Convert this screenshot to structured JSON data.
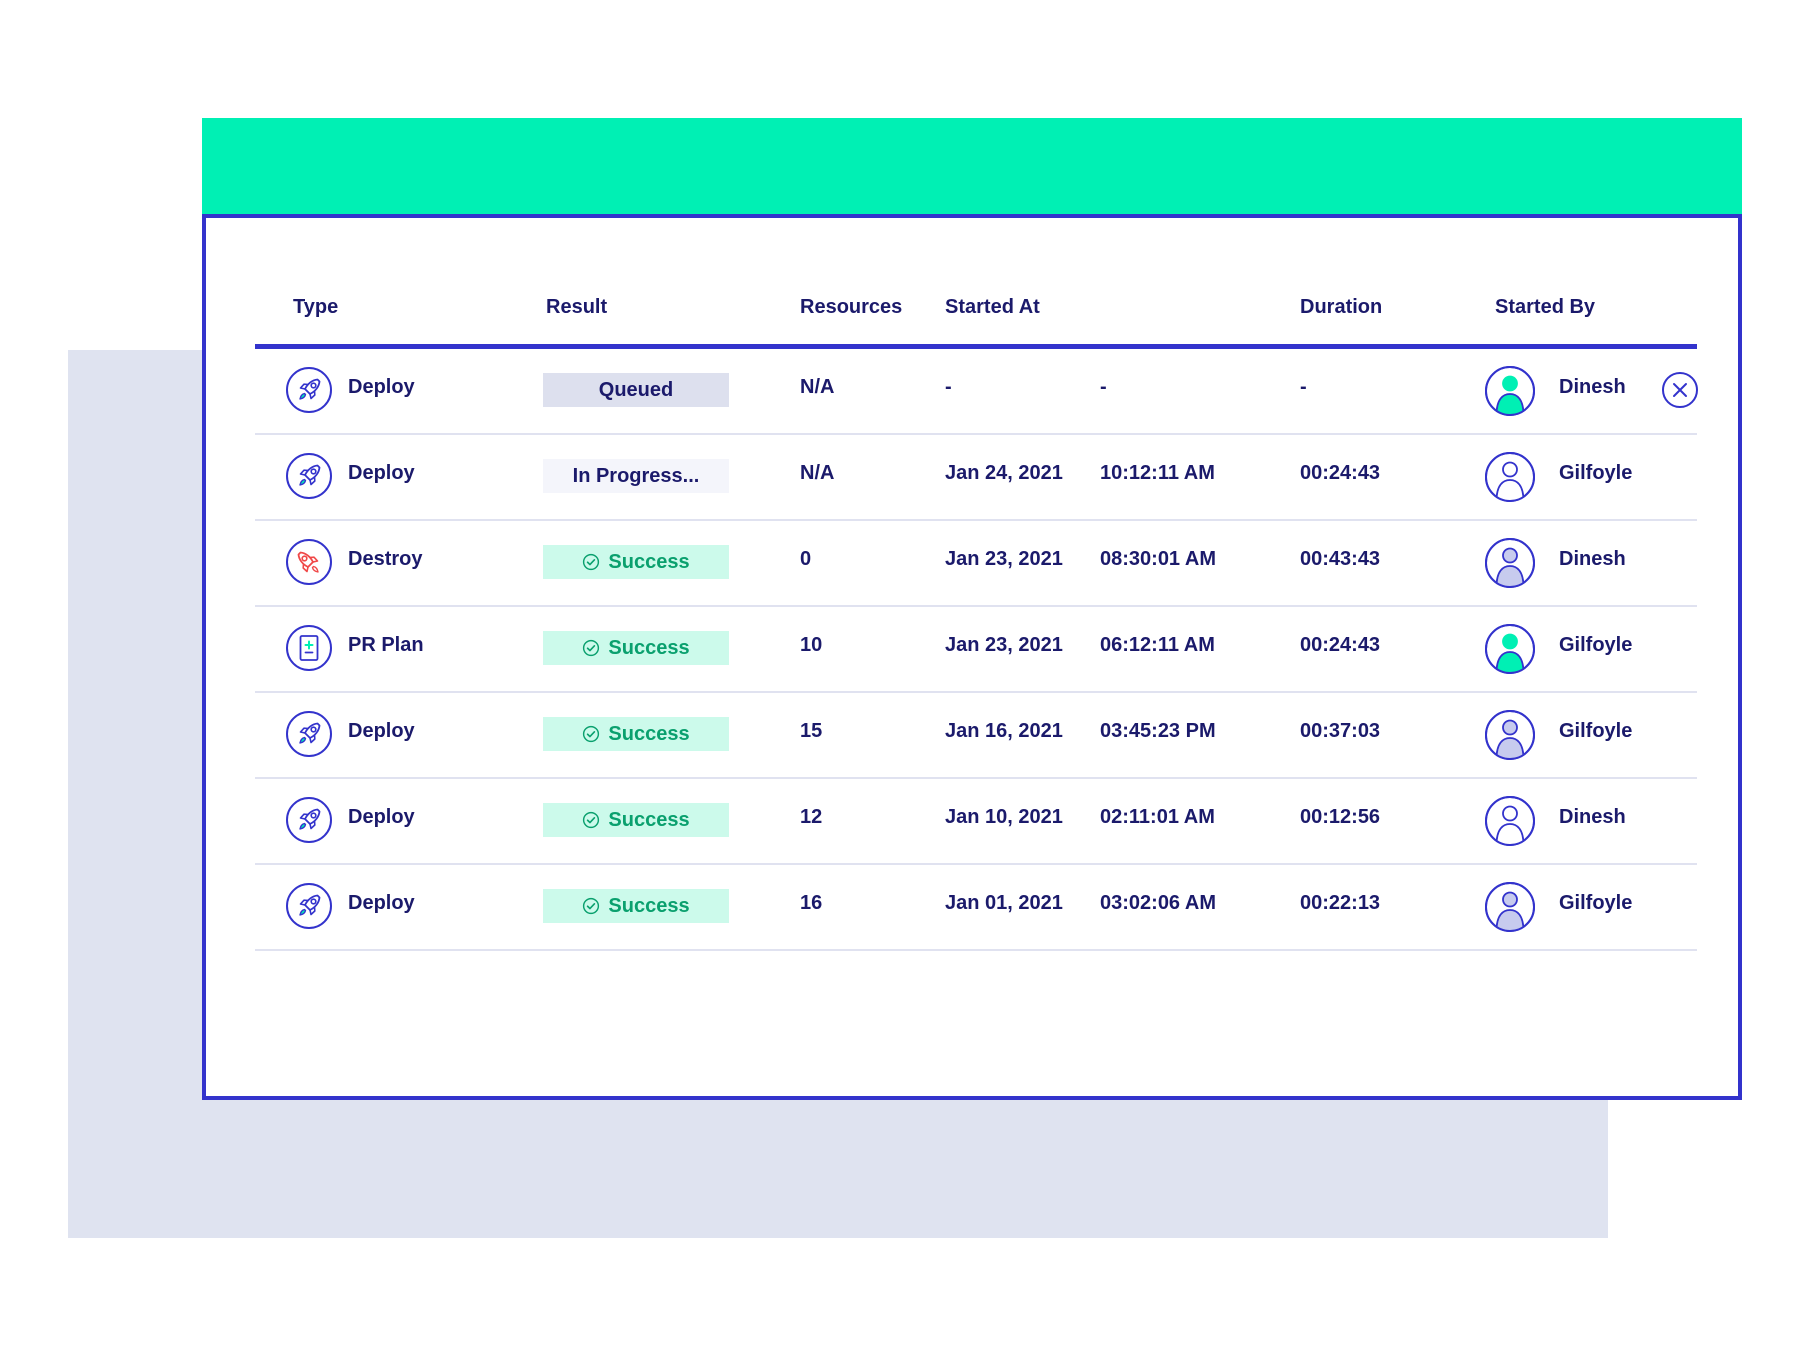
{
  "colors": {
    "accent": "#3333cc",
    "header_band": "#00f0b4",
    "text": "#1b1a6b",
    "success_bg": "#ccfaeb",
    "success_text": "#0aa06e",
    "queued_bg": "#dde0ee",
    "destroy_icon": "#f04848",
    "backdrop": "#dfe3f0"
  },
  "table": {
    "headers": {
      "type": "Type",
      "result": "Result",
      "resources": "Resources",
      "started_at": "Started At",
      "duration": "Duration",
      "started_by": "Started By"
    },
    "rows": [
      {
        "type": "Deploy",
        "type_icon": "rocket-icon",
        "result": "Queued",
        "result_style": "queued",
        "resources": "N/A",
        "date": "-",
        "time": "-",
        "duration": "-",
        "user": "Dinesh",
        "avatar_style": "filled",
        "cancel_icon": "close-icon"
      },
      {
        "type": "Deploy",
        "type_icon": "rocket-icon",
        "result": "In Progress...",
        "result_style": "progress",
        "resources": "N/A",
        "date": "Jan 24, 2021",
        "time": "10:12:11 AM",
        "duration": "00:24:43",
        "user": "Gilfoyle",
        "avatar_style": "outline"
      },
      {
        "type": "Destroy",
        "type_icon": "destroy-rocket-icon",
        "result": "Success",
        "result_style": "success",
        "resources": "0",
        "date": "Jan 23, 2021",
        "time": "08:30:01 AM",
        "duration": "00:43:43",
        "user": "Dinesh",
        "avatar_style": "lavender"
      },
      {
        "type": "PR Plan",
        "type_icon": "plan-document-icon",
        "result": "Success",
        "result_style": "success",
        "resources": "10",
        "date": "Jan 23, 2021",
        "time": "06:12:11 AM",
        "duration": "00:24:43",
        "user": "Gilfoyle",
        "avatar_style": "filled"
      },
      {
        "type": "Deploy",
        "type_icon": "rocket-icon",
        "result": "Success",
        "result_style": "success",
        "resources": "15",
        "date": "Jan 16, 2021",
        "time": "03:45:23 PM",
        "duration": "00:37:03",
        "user": "Gilfoyle",
        "avatar_style": "lavender"
      },
      {
        "type": "Deploy",
        "type_icon": "rocket-icon",
        "result": "Success",
        "result_style": "success",
        "resources": "12",
        "date": "Jan 10, 2021",
        "time": "02:11:01 AM",
        "duration": "00:12:56",
        "user": "Dinesh",
        "avatar_style": "outline"
      },
      {
        "type": "Deploy",
        "type_icon": "rocket-icon",
        "result": "Success",
        "result_style": "success",
        "resources": "16",
        "date": "Jan 01, 2021",
        "time": "03:02:06 AM",
        "duration": "00:22:13",
        "user": "Gilfoyle",
        "avatar_style": "lavender"
      }
    ]
  }
}
